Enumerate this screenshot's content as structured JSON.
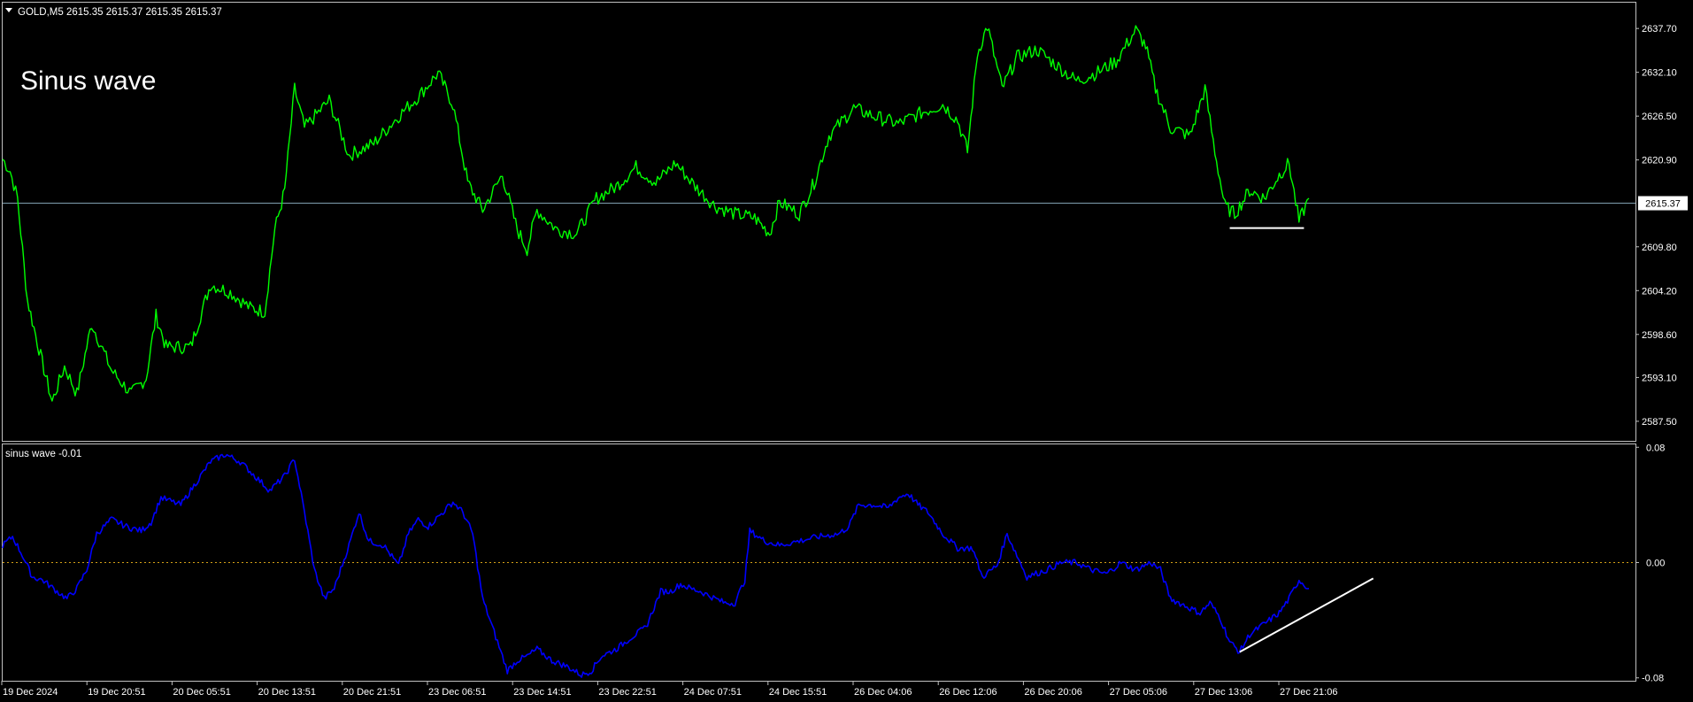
{
  "header": {
    "symbol_line": "GOLD,M5  2615.35 2615.37 2615.35 2615.37"
  },
  "annotation": {
    "label": "Sinus wave"
  },
  "indicator": {
    "title": "sinus wave -0.01"
  },
  "colors": {
    "background": "#000000",
    "price_line": "#00ff00",
    "indicator_line": "#0000ff",
    "zero_line": "#d4a017",
    "frame": "#c0c0c0",
    "current_price_line": "#7f9fb0",
    "trend_line": "#ffffff"
  },
  "chart_data": [
    {
      "type": "line",
      "title": "GOLD,M5",
      "series": [
        {
          "name": "GOLD,M5",
          "points": [
            [
              0,
              2621.0
            ],
            [
              1.5,
              2619.5
            ],
            [
              3,
              2616.0
            ],
            [
              5,
              2603.0
            ],
            [
              8,
              2595.0
            ],
            [
              10,
              2590.0
            ],
            [
              12.5,
              2594.5
            ],
            [
              15,
              2591.0
            ],
            [
              18,
              2600.0
            ],
            [
              22,
              2594.0
            ],
            [
              26,
              2591.0
            ],
            [
              29,
              2593.0
            ],
            [
              31,
              2601.0
            ],
            [
              33,
              2597.0
            ],
            [
              38,
              2597.0
            ],
            [
              40,
              2601.0
            ],
            [
              42,
              2605.0
            ],
            [
              46,
              2604.0
            ],
            [
              50,
              2602.0
            ],
            [
              53,
              2601.5
            ],
            [
              55,
              2612.0
            ],
            [
              57,
              2617.0
            ],
            [
              59,
              2630.0
            ],
            [
              61,
              2625.0
            ],
            [
              66,
              2628.5
            ],
            [
              70,
              2621.5
            ],
            [
              75,
              2623.0
            ],
            [
              80,
              2626.5
            ],
            [
              84,
              2629.0
            ],
            [
              88,
              2632.0
            ],
            [
              91,
              2628.0
            ],
            [
              94,
              2618.0
            ],
            [
              97,
              2614.5
            ],
            [
              101,
              2619.0
            ],
            [
              104,
              2612.0
            ],
            [
              106,
              2609.5
            ],
            [
              108,
              2614.5
            ],
            [
              112,
              2612.0
            ],
            [
              116,
              2611.5
            ],
            [
              120,
              2616.0
            ],
            [
              124,
              2617.5
            ],
            [
              128,
              2620.0
            ],
            [
              132,
              2618.0
            ],
            [
              136,
              2620.5
            ],
            [
              140,
              2617.5
            ],
            [
              144,
              2615.0
            ],
            [
              148,
              2614.0
            ],
            [
              152,
              2613.5
            ],
            [
              155,
              2611.5
            ],
            [
              157,
              2615.5
            ],
            [
              161,
              2614.0
            ],
            [
              164,
              2618.0
            ],
            [
              167,
              2624.0
            ],
            [
              172,
              2627.5
            ],
            [
              176,
              2626.5
            ],
            [
              181,
              2625.5
            ],
            [
              186,
              2627.0
            ],
            [
              190,
              2628.0
            ],
            [
              193,
              2626.0
            ],
            [
              195,
              2622.0
            ],
            [
              197,
              2634.5
            ],
            [
              199,
              2638.0
            ],
            [
              202,
              2630.0
            ],
            [
              205,
              2634.0
            ],
            [
              209,
              2635.0
            ],
            [
              213,
              2633.0
            ],
            [
              217,
              2631.0
            ],
            [
              221,
              2632.0
            ],
            [
              225,
              2633.5
            ],
            [
              229,
              2637.5
            ],
            [
              231,
              2635.5
            ],
            [
              233,
              2630.0
            ],
            [
              236,
              2625.0
            ],
            [
              240,
              2624.0
            ],
            [
              243,
              2630.0
            ],
            [
              245,
              2622.0
            ],
            [
              247,
              2615.0
            ],
            [
              249,
              2614.0
            ],
            [
              252,
              2617.0
            ],
            [
              255,
              2616.0
            ],
            [
              258,
              2619.0
            ],
            [
              260,
              2620.5
            ],
            [
              262,
              2613.0
            ],
            [
              264,
              2616.0
            ]
          ]
        }
      ],
      "x_ticks": [
        "19 Dec 2024",
        "19 Dec 20:51",
        "20 Dec 05:51",
        "20 Dec 13:51",
        "20 Dec 21:51",
        "23 Dec 06:51",
        "23 Dec 14:51",
        "23 Dec 22:51",
        "24 Dec 07:51",
        "24 Dec 15:51",
        "26 Dec 04:06",
        "26 Dec 12:06",
        "26 Dec 20:06",
        "27 Dec 05:06",
        "27 Dec 13:06",
        "27 Dec 21:06"
      ],
      "y_ticks": [
        "2637.70",
        "2632.10",
        "2626.50",
        "2620.90",
        "2615.30",
        "2609.80",
        "2604.20",
        "2598.60",
        "2593.10",
        "2587.50"
      ],
      "y_tick_values": [
        2637.7,
        2632.1,
        2626.5,
        2620.9,
        2615.3,
        2609.8,
        2604.2,
        2598.6,
        2593.1,
        2587.5
      ],
      "ylim": [
        2585.0,
        2641.0
      ],
      "xlim": [
        0,
        330
      ],
      "current_price": 2615.37,
      "current_price_label": "2615.37",
      "support_line": {
        "x": [
          248,
          263
        ],
        "y": 2612.2
      },
      "grid": false,
      "legend": "none"
    },
    {
      "type": "line",
      "title": "sinus wave -0.01",
      "series": [
        {
          "name": "sinus wave",
          "points": [
            [
              0,
              0.012
            ],
            [
              2,
              0.018
            ],
            [
              4,
              0.005
            ],
            [
              6,
              -0.01
            ],
            [
              8,
              -0.012
            ],
            [
              11,
              -0.02
            ],
            [
              13,
              -0.025
            ],
            [
              15,
              -0.018
            ],
            [
              17,
              -0.005
            ],
            [
              19,
              0.02
            ],
            [
              22,
              0.03
            ],
            [
              25,
              0.025
            ],
            [
              28,
              0.022
            ],
            [
              30,
              0.028
            ],
            [
              32,
              0.045
            ],
            [
              36,
              0.04
            ],
            [
              39,
              0.055
            ],
            [
              42,
              0.07
            ],
            [
              45,
              0.075
            ],
            [
              48,
              0.07
            ],
            [
              51,
              0.06
            ],
            [
              54,
              0.05
            ],
            [
              57,
              0.06
            ],
            [
              59,
              0.072
            ],
            [
              61,
              0.035
            ],
            [
              63,
              -0.005
            ],
            [
              65,
              -0.025
            ],
            [
              67,
              -0.018
            ],
            [
              70,
              0.012
            ],
            [
              72,
              0.035
            ],
            [
              74,
              0.015
            ],
            [
              77,
              0.012
            ],
            [
              80,
              -0.002
            ],
            [
              82,
              0.02
            ],
            [
              84,
              0.03
            ],
            [
              86,
              0.025
            ],
            [
              89,
              0.035
            ],
            [
              91,
              0.042
            ],
            [
              93,
              0.035
            ],
            [
              95,
              0.02
            ],
            [
              97,
              -0.025
            ],
            [
              100,
              -0.055
            ],
            [
              102,
              -0.075
            ],
            [
              104,
              -0.068
            ],
            [
              106,
              -0.065
            ],
            [
              108,
              -0.06
            ],
            [
              111,
              -0.068
            ],
            [
              114,
              -0.072
            ],
            [
              117,
              -0.078
            ],
            [
              119,
              -0.075
            ],
            [
              121,
              -0.065
            ],
            [
              124,
              -0.06
            ],
            [
              127,
              -0.052
            ],
            [
              130,
              -0.045
            ],
            [
              133,
              -0.02
            ],
            [
              135,
              -0.02
            ],
            [
              137,
              -0.015
            ],
            [
              139,
              -0.018
            ],
            [
              141,
              -0.02
            ],
            [
              144,
              -0.025
            ],
            [
              146,
              -0.028
            ],
            [
              148,
              -0.028
            ],
            [
              150,
              -0.012
            ],
            [
              151,
              0.022
            ],
            [
              154,
              0.015
            ],
            [
              157,
              0.012
            ],
            [
              161,
              0.015
            ],
            [
              165,
              0.018
            ],
            [
              169,
              0.02
            ],
            [
              171,
              0.025
            ],
            [
              173,
              0.04
            ],
            [
              176,
              0.04
            ],
            [
              179,
              0.038
            ],
            [
              181,
              0.045
            ],
            [
              183,
              0.048
            ],
            [
              185,
              0.04
            ],
            [
              187,
              0.035
            ],
            [
              190,
              0.02
            ],
            [
              193,
              0.01
            ],
            [
              196,
              0.01
            ],
            [
              198,
              -0.01
            ],
            [
              201,
              -0.002
            ],
            [
              203,
              0.02
            ],
            [
              205,
              0.005
            ],
            [
              207,
              -0.01
            ],
            [
              211,
              -0.005
            ],
            [
              214,
              0.0
            ],
            [
              217,
              0.0
            ],
            [
              220,
              -0.005
            ],
            [
              223,
              -0.008
            ],
            [
              226,
              0.0
            ],
            [
              229,
              -0.005
            ],
            [
              232,
              0.0
            ],
            [
              234,
              -0.005
            ],
            [
              236,
              -0.025
            ],
            [
              239,
              -0.03
            ],
            [
              242,
              -0.035
            ],
            [
              244,
              -0.028
            ],
            [
              246,
              -0.038
            ],
            [
              248,
              -0.055
            ],
            [
              250,
              -0.062
            ],
            [
              252,
              -0.05
            ],
            [
              254,
              -0.045
            ],
            [
              256,
              -0.04
            ],
            [
              258,
              -0.035
            ],
            [
              260,
              -0.025
            ],
            [
              262,
              -0.012
            ],
            [
              264,
              -0.018
            ]
          ]
        }
      ],
      "y_ticks": [
        "0.08",
        "0.00",
        "-0.08"
      ],
      "y_tick_values": [
        0.08,
        0.0,
        -0.08
      ],
      "ylim": [
        -0.082,
        0.082
      ],
      "zero_level": 0.0,
      "trend_line": {
        "x": [
          250,
          277
        ],
        "y": [
          -0.062,
          -0.011
        ]
      },
      "grid": false,
      "legend": "none"
    }
  ]
}
